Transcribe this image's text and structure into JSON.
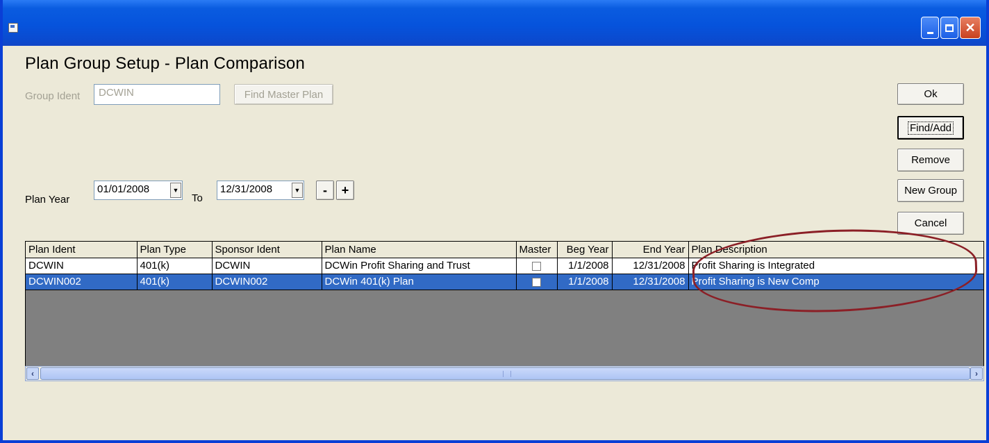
{
  "window": {
    "title_icon": "app-icon",
    "controls": {
      "minimize": "minimize-icon",
      "maximize": "maximize-icon",
      "close": "close-icon"
    },
    "accent": "#0653dc"
  },
  "heading": "Plan Group Setup - Plan Comparison",
  "group_ident": {
    "label": "Group Ident",
    "value": "DCWIN"
  },
  "find_master_plan_label": "Find Master Plan",
  "plan_year": {
    "label": "Plan Year",
    "from": "01/01/2008",
    "to_label": "To",
    "to": "12/31/2008",
    "minus_label": "-",
    "plus_label": "+"
  },
  "actions": {
    "ok": "Ok",
    "find_add": "Find/Add",
    "remove": "Remove",
    "new_group": "New Group",
    "cancel": "Cancel"
  },
  "grid": {
    "columns": [
      "Plan Ident",
      "Plan Type",
      "Sponsor Ident",
      "Plan Name",
      "Master",
      "Beg Year",
      "End Year",
      "Plan Description"
    ],
    "rows": [
      {
        "plan_ident": "DCWIN",
        "plan_type": "401(k)",
        "sponsor_ident": "DCWIN",
        "plan_name": "DCWin Profit Sharing and Trust",
        "master": false,
        "beg_year": "1/1/2008",
        "end_year": "12/31/2008",
        "plan_description": "Profit Sharing is Integrated",
        "selected": false
      },
      {
        "plan_ident": "DCWIN002",
        "plan_type": "401(k)",
        "sponsor_ident": "DCWIN002",
        "plan_name": "DCWin 401(k) Plan",
        "master": false,
        "beg_year": "1/1/2008",
        "end_year": "12/31/2008",
        "plan_description": "Profit Sharing is New Comp",
        "selected": true
      }
    ]
  },
  "annotation_color": "#8b1f26"
}
